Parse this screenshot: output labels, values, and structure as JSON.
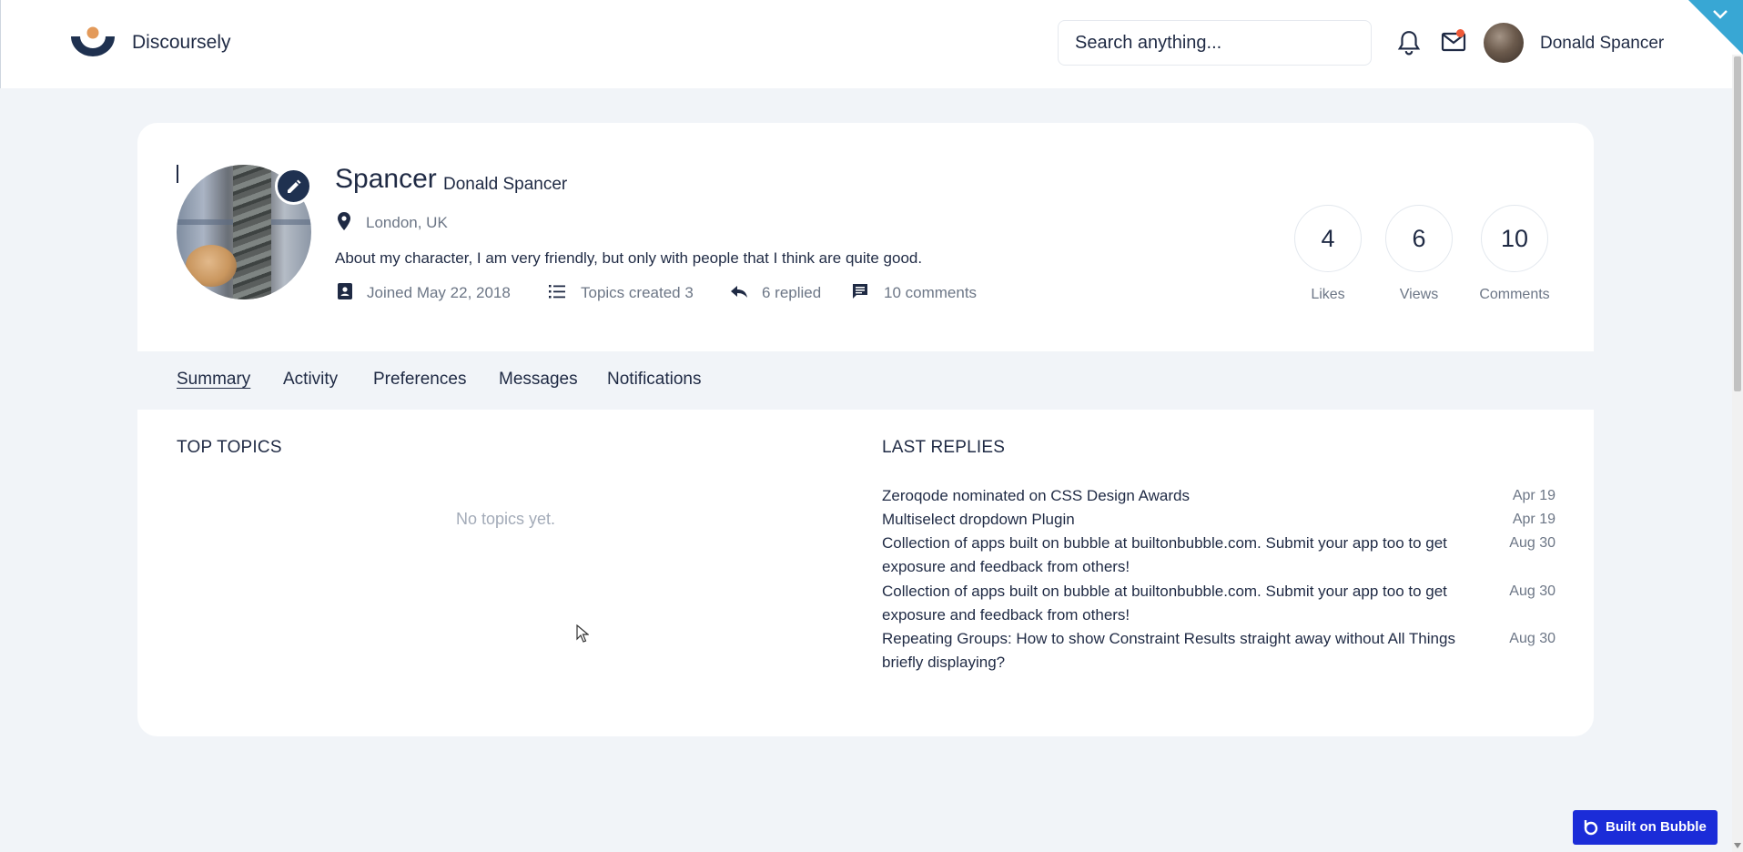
{
  "header": {
    "brand": "Discoursely",
    "search_placeholder": "Search anything...",
    "username": "Donald Spancer",
    "icons": [
      "logo-icon",
      "bell-icon",
      "mail-icon",
      "avatar"
    ],
    "mail_badge_color": "#f05a38",
    "corner_color": "#38a7d4"
  },
  "profile": {
    "display_name": "Spancer",
    "full_name": "Donald Spancer",
    "location": "London, UK",
    "bio": "About my character, I am very friendly, but only with people that I think are quite good.",
    "joined": "Joined May 22, 2018",
    "topics_created": "Topics created 3",
    "replied": "6 replied",
    "comments": "10 comments"
  },
  "stats": [
    {
      "value": "4",
      "label": "Likes"
    },
    {
      "value": "6",
      "label": "Views"
    },
    {
      "value": "10",
      "label": "Comments"
    }
  ],
  "tabs": [
    {
      "label": "Summary",
      "active": true
    },
    {
      "label": "Activity"
    },
    {
      "label": "Preferences"
    },
    {
      "label": "Messages"
    },
    {
      "label": "Notifications"
    }
  ],
  "top_topics": {
    "title": "TOP TOPICS",
    "empty": "No topics yet."
  },
  "last_replies": {
    "title": "LAST REPLIES",
    "items": [
      {
        "title": "Zeroqode nominated on CSS Design Awards",
        "date": "Apr 19"
      },
      {
        "title": "Multiselect dropdown Plugin",
        "date": "Apr 19"
      },
      {
        "title": "Collection of apps built on bubble at builtonbubble.com. Submit your app too to get exposure and feedback from others!",
        "date": "Aug 30"
      },
      {
        "title": "Collection of apps built on bubble at builtonbubble.com. Submit your app too to get exposure and feedback from others!",
        "date": "Aug 30"
      },
      {
        "title": "Repeating Groups: How to show Constraint Results straight away without All Things briefly displaying?",
        "date": "Aug 30"
      }
    ]
  },
  "footer_badge": "Built on Bubble",
  "colors": {
    "accent_dark": "#1f3150",
    "page_bg": "#f1f4f8",
    "badge_blue": "#1b2cd8",
    "logo_orange": "#e39a5a"
  }
}
